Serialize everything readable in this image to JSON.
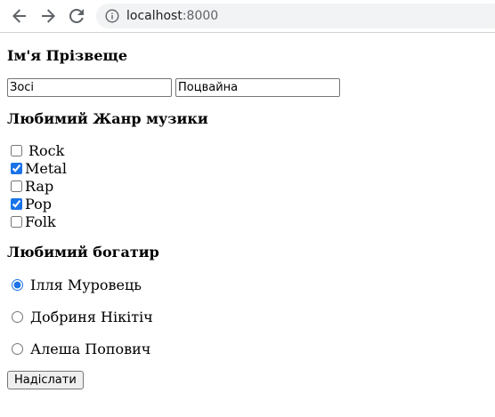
{
  "browser": {
    "url_host": "localhost",
    "url_port": ":8000"
  },
  "form": {
    "name_heading": "Ім'я Прізвеще",
    "first_name_value": "Зосі",
    "last_name_value": "Поцвайна",
    "genre_heading": "Любимий Жанр музики",
    "genres": [
      {
        "label": "Rock",
        "checked": false
      },
      {
        "label": "Metal",
        "checked": true
      },
      {
        "label": "Rap",
        "checked": false
      },
      {
        "label": "Pop",
        "checked": true
      },
      {
        "label": "Folk",
        "checked": false
      }
    ],
    "hero_heading": "Любимий богатир",
    "heroes": [
      {
        "label": "Ілля Муровець",
        "selected": true
      },
      {
        "label": "Добриня Нікітіч",
        "selected": false
      },
      {
        "label": "Алеша Попович",
        "selected": false
      }
    ],
    "submit_label": "Надіслати"
  },
  "colors": {
    "accent": "#1a73e8",
    "omnibox_bg": "#f1f3f4"
  }
}
